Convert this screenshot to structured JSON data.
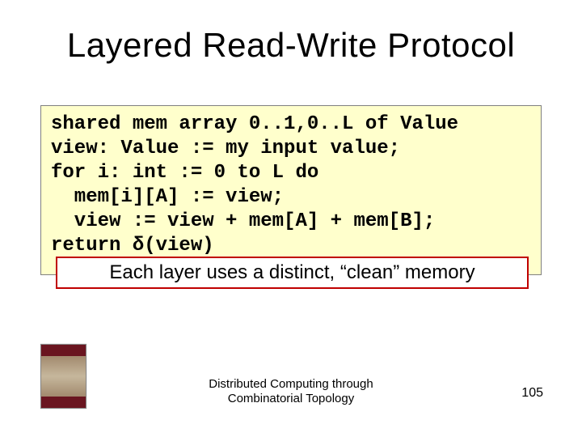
{
  "title": "Layered Read-Write Protocol",
  "code": {
    "l1": "shared mem array 0..1,0..L of Value",
    "l2": "view: Value := my input value;",
    "l3": "for i: int := 0 to L do",
    "l4": "  mem[i][A] := view;",
    "l5": "  view := view + mem[A] + mem[B];",
    "l6": "return δ(view)"
  },
  "callout": "Each layer uses a distinct, “clean” memory",
  "footer_line1": "Distributed Computing through",
  "footer_line2": "Combinatorial Topology",
  "page_number": "105"
}
